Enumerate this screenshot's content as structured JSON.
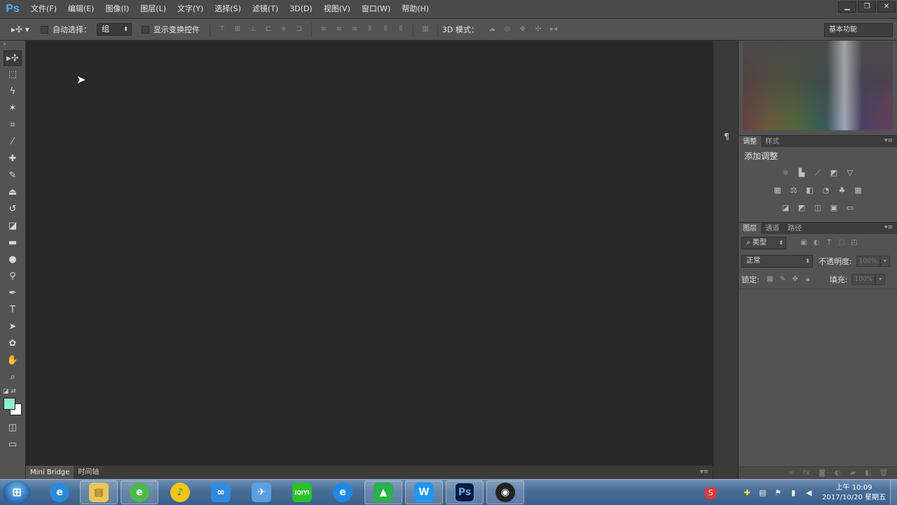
{
  "app": {
    "logo": "Ps"
  },
  "menu": [
    "文件(F)",
    "编辑(E)",
    "图像(I)",
    "图层(L)",
    "文字(Y)",
    "选择(S)",
    "滤镜(T)",
    "3D(D)",
    "视图(V)",
    "窗口(W)",
    "帮助(H)"
  ],
  "window_controls": {
    "minimize": "▁",
    "restore": "❐",
    "close": "✕"
  },
  "options": {
    "auto_select_label": "自动选择：",
    "auto_select_value": "组",
    "show_transform_label": "显示变换控件",
    "mode_3d_label": "3D 模式：",
    "workspace": "基本功能"
  },
  "bottom_tabs": [
    "Mini Bridge",
    "时间轴"
  ],
  "adjustments": {
    "tabs": [
      "调整",
      "样式"
    ],
    "title": "添加调整"
  },
  "layers": {
    "tabs": [
      "图层",
      "通道",
      "路径"
    ],
    "filter_kind": "类型",
    "blend_mode": "正常",
    "opacity_label": "不透明度:",
    "opacity_value": "100%",
    "lock_label": "锁定:",
    "fill_label": "填充:",
    "fill_value": "100%"
  },
  "colors": {
    "foreground": "#8ff0c8",
    "background": "#ffffff",
    "ps_blue": "#58a9ef"
  },
  "taskbar": {
    "clock_time": "上午 10:09",
    "clock_date": "2017/10/20 星期五",
    "apps": [
      {
        "name": "internet-explorer",
        "label": "e"
      },
      {
        "name": "file-explorer",
        "label": "▤"
      },
      {
        "name": "360-browser",
        "label": "e"
      },
      {
        "name": "qq-music",
        "label": "♪"
      },
      {
        "name": "baidu-netdisk",
        "label": "∞"
      },
      {
        "name": "feishu",
        "label": "✈"
      },
      {
        "name": "iqiyi",
        "label": "iQIYI"
      },
      {
        "name": "ie-browser",
        "label": "e"
      },
      {
        "name": "evernote",
        "label": "▲"
      },
      {
        "name": "wps",
        "label": "W"
      },
      {
        "name": "photoshop",
        "label": "Ps"
      },
      {
        "name": "obs",
        "label": "◉"
      }
    ]
  }
}
